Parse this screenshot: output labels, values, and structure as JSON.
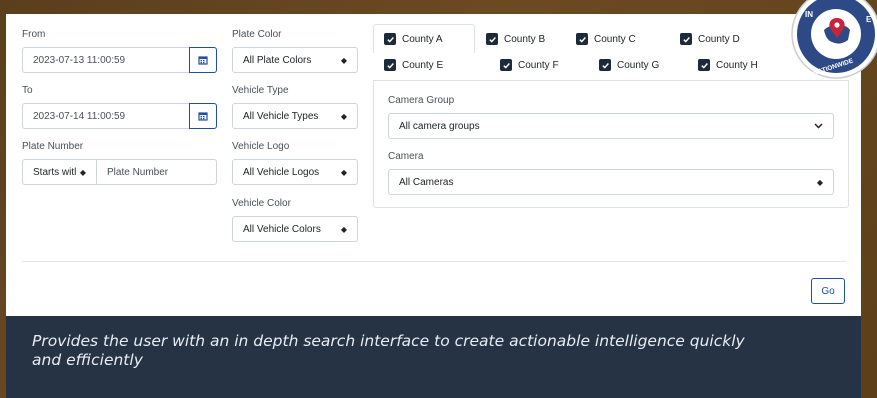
{
  "form": {
    "from_label": "From",
    "from_value": "2023-07-13 11:00:59",
    "to_label": "To",
    "to_value": "2023-07-14 11:00:59",
    "plate_number_label": "Plate Number",
    "plate_match_selected": "Starts witl",
    "plate_number_placeholder": "Plate Number",
    "plate_color_label": "Plate Color",
    "plate_color_selected": "All Plate Colors",
    "vehicle_type_label": "Vehicle Type",
    "vehicle_type_selected": "All Vehicle Types",
    "vehicle_logo_label": "Vehicle Logo",
    "vehicle_logo_selected": "All Vehicle Logos",
    "vehicle_color_label": "Vehicle Color",
    "vehicle_color_selected": "All Vehicle Colors"
  },
  "counties": [
    {
      "label": "County A",
      "checked": true
    },
    {
      "label": "County B",
      "checked": true
    },
    {
      "label": "County C",
      "checked": true
    },
    {
      "label": "County D",
      "checked": true
    },
    {
      "label": "County E",
      "checked": true
    },
    {
      "label": "County F",
      "checked": true
    },
    {
      "label": "County G",
      "checked": true
    },
    {
      "label": "County H",
      "checked": true
    }
  ],
  "camera": {
    "group_label": "Camera Group",
    "group_selected": "All camera groups",
    "camera_label": "Camera",
    "camera_selected": "All Cameras"
  },
  "actions": {
    "go_label": "Go"
  },
  "caption": "Provides the user with an in depth search interface to create actionable intelligence quickly and efficiently",
  "seal": {
    "text_top": "IN",
    "text_right": "E",
    "text_bottom": "NATIONWIDE"
  },
  "colors": {
    "accent": "#1f4fa0",
    "checkbox": "#1d2a3b",
    "caption_bg": "#263345",
    "page_bg": "#5a3f1c"
  },
  "icons": {
    "date_button": "calendar-icon",
    "checkbox": "checkmark-icon",
    "select": "updown-caret-icon"
  }
}
